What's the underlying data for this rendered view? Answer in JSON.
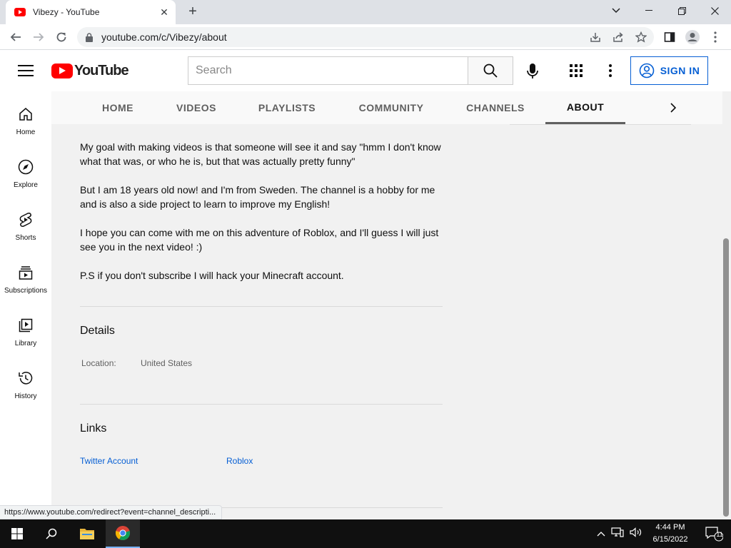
{
  "browser": {
    "tab_title": "Vibezy - YouTube",
    "url": "youtube.com/c/Vibezy/about",
    "status_url": "https://www.youtube.com/redirect?event=channel_descripti..."
  },
  "header": {
    "logo_text": "YouTube",
    "search_placeholder": "Search",
    "sign_in": "SIGN IN"
  },
  "guide": {
    "items": [
      {
        "label": "Home",
        "icon": "home-icon"
      },
      {
        "label": "Explore",
        "icon": "compass-icon"
      },
      {
        "label": "Shorts",
        "icon": "shorts-icon"
      },
      {
        "label": "Subscriptions",
        "icon": "subscriptions-icon"
      },
      {
        "label": "Library",
        "icon": "library-icon"
      },
      {
        "label": "History",
        "icon": "history-icon"
      }
    ]
  },
  "channel_tabs": {
    "items": [
      "HOME",
      "VIDEOS",
      "PLAYLISTS",
      "COMMUNITY",
      "CHANNELS",
      "ABOUT"
    ],
    "active": "ABOUT"
  },
  "about": {
    "paragraphs": [
      "My goal with making videos is that someone will see it and say \"hmm I don't know what that was, or who he is, but that was actually pretty funny\"",
      "But I am 18 years old now! and I'm from Sweden. The channel is a hobby for me and is also a side project to learn to improve my English!",
      "I hope you can come with me on this adventure of Roblox, and I'll guess I will just see you in the next video! :)",
      "P.S if you don't subscribe I will hack your Minecraft account."
    ],
    "details_title": "Details",
    "location_label": "Location:",
    "location_value": "United States",
    "links_title": "Links",
    "links": [
      "Twitter Account",
      "Roblox"
    ]
  },
  "taskbar": {
    "time": "4:44 PM",
    "date": "6/15/2022",
    "notification_count": "11"
  },
  "colors": {
    "brand_red": "#ff0000",
    "link_blue": "#065fd4"
  }
}
